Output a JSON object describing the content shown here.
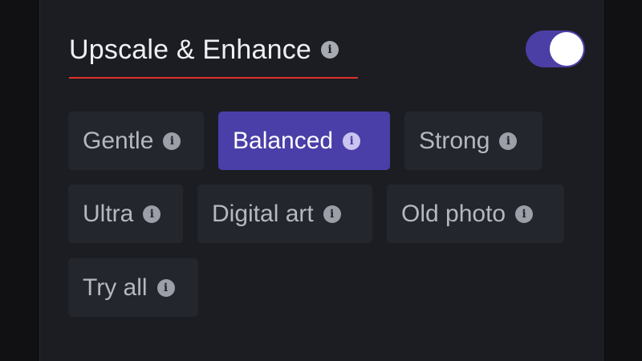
{
  "section": {
    "title": "Upscale & Enhance",
    "info_icon": "info-icon",
    "toggle_on": true,
    "accent_color": "#4a3ea8",
    "underline_color": "#e0302a"
  },
  "options": [
    {
      "label": "Gentle",
      "selected": false,
      "icon": "info-icon"
    },
    {
      "label": "Balanced",
      "selected": true,
      "icon": "info-icon"
    },
    {
      "label": "Strong",
      "selected": false,
      "icon": "info-icon"
    },
    {
      "label": "Ultra",
      "selected": false,
      "icon": "info-icon"
    },
    {
      "label": "Digital art",
      "selected": false,
      "icon": "info-icon"
    },
    {
      "label": "Old photo",
      "selected": false,
      "icon": "info-icon"
    },
    {
      "label": "Try all",
      "selected": false,
      "icon": "info-icon"
    }
  ],
  "info_glyph": "i"
}
